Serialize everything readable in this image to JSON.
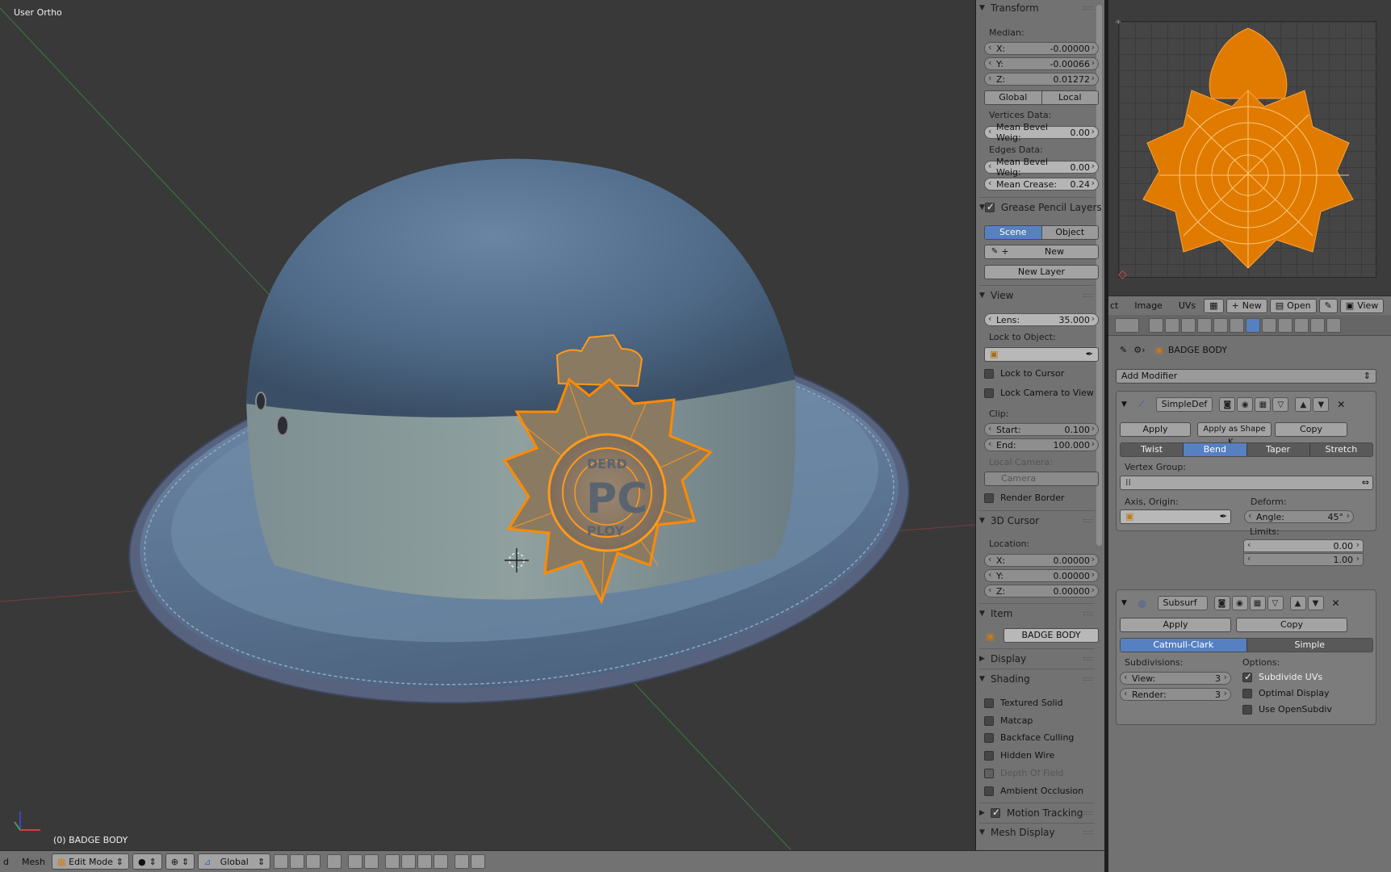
{
  "viewport": {
    "label": "User Ortho",
    "status": "(0) BADGE BODY",
    "badge_text_top": "DERD",
    "badge_text_mid": "PC",
    "badge_text_bottom": "PLOY"
  },
  "transform": {
    "title": "Transform",
    "median_label": "Median:",
    "x_label": "X:",
    "x_value": "-0.00000",
    "y_label": "Y:",
    "y_value": "-0.00066",
    "z_label": "Z:",
    "z_value": "0.01272",
    "global": "Global",
    "local": "Local",
    "vertices_label": "Vertices Data:",
    "mean_bevel_v_label": "Mean Bevel Weig:",
    "mean_bevel_v_value": "0.00",
    "edges_label": "Edges Data:",
    "mean_bevel_e_label": "Mean Bevel Weig:",
    "mean_bevel_e_value": "0.00",
    "mean_crease_label": "Mean Crease:",
    "mean_crease_value": "0.24"
  },
  "grease": {
    "title": "Grease Pencil Layers",
    "scene": "Scene",
    "object": "Object",
    "new": "New",
    "new_layer": "New Layer"
  },
  "view": {
    "title": "View",
    "lens_label": "Lens:",
    "lens_value": "35.000",
    "lock_object_label": "Lock to Object:",
    "lock_cursor": "Lock to Cursor",
    "lock_camera": "Lock Camera to View",
    "clip_label": "Clip:",
    "start_label": "Start:",
    "start_value": "0.100",
    "end_label": "End:",
    "end_value": "100.000",
    "local_camera_label": "Local Camera:",
    "camera": "Camera",
    "render_border": "Render Border"
  },
  "cursor": {
    "title": "3D Cursor",
    "location_label": "Location:",
    "x_label": "X:",
    "x_value": "0.00000",
    "y_label": "Y:",
    "y_value": "0.00000",
    "z_label": "Z:",
    "z_value": "0.00000"
  },
  "item": {
    "title": "Item",
    "name": "BADGE BODY"
  },
  "display": {
    "title": "Display"
  },
  "shading": {
    "title": "Shading",
    "textured_solid": "Textured Solid",
    "matcap": "Matcap",
    "backface": "Backface Culling",
    "hidden_wire": "Hidden Wire",
    "depth_of_field": "Depth Of Field",
    "ambient_occlusion": "Ambient Occlusion"
  },
  "motion_tracking": {
    "title": "Motion Tracking"
  },
  "mesh_display": {
    "title": "Mesh Display"
  },
  "uv_header": {
    "menu_ct": "ct",
    "image": "Image",
    "uvs": "UVs",
    "new": "New",
    "open": "Open",
    "view": "View"
  },
  "properties": {
    "object_name": "BADGE BODY",
    "add_modifier": "Add Modifier",
    "simpledef": {
      "name": "SimpleDef",
      "apply": "Apply",
      "apply_shape": "Apply as Shape K...",
      "copy": "Copy",
      "twist": "Twist",
      "bend": "Bend",
      "taper": "Taper",
      "stretch": "Stretch",
      "vertex_group_label": "Vertex Group:",
      "axis_origin_label": "Axis, Origin:",
      "deform_label": "Deform:",
      "angle_label": "Angle:",
      "angle_value": "45°",
      "limits_label": "Limits:",
      "limit_min": "0.00",
      "limit_max": "1.00"
    },
    "subsurf": {
      "name": "Subsurf",
      "apply": "Apply",
      "copy": "Copy",
      "catmull": "Catmull-Clark",
      "simple": "Simple",
      "subdivisions_label": "Subdivisions:",
      "view_label": "View:",
      "view_value": "3",
      "render_label": "Render:",
      "render_value": "3",
      "options_label": "Options:",
      "subdivide_uvs": "Subdivide UVs",
      "optimal_display": "Optimal Display",
      "use_opensubdiv": "Use OpenSubdiv"
    }
  },
  "footer": {
    "menu_d": "d",
    "mesh": "Mesh",
    "mode": "Edit Mode",
    "orientation": "Global"
  }
}
